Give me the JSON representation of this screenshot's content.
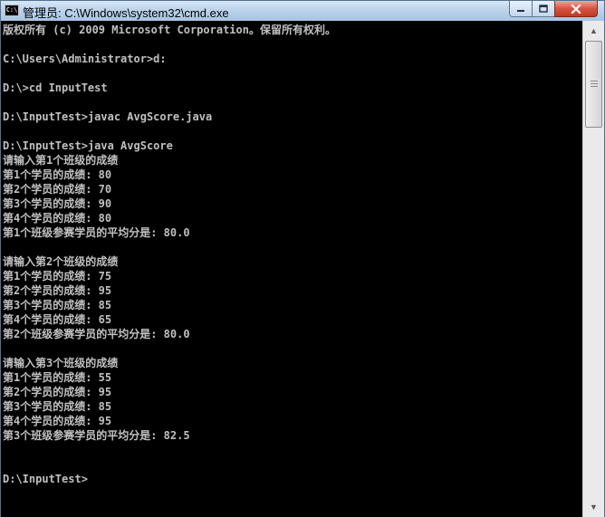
{
  "window": {
    "title": "管理员: C:\\Windows\\system32\\cmd.exe",
    "icon": "cmd-icon",
    "icon_text": "C:\\"
  },
  "controls": {
    "minimize_icon": "minimize-icon",
    "maximize_icon": "maximize-icon",
    "close_icon": "close-icon"
  },
  "console": {
    "lines": [
      "版权所有 (c) 2009 Microsoft Corporation。保留所有权利。",
      "",
      "C:\\Users\\Administrator>d:",
      "",
      "D:\\>cd InputTest",
      "",
      "D:\\InputTest>javac AvgScore.java",
      "",
      "D:\\InputTest>java AvgScore",
      "请输入第1个班级的成绩",
      "第1个学员的成绩: 80",
      "第2个学员的成绩: 70",
      "第3个学员的成绩: 90",
      "第4个学员的成绩: 80",
      "第1个班级参赛学员的平均分是: 80.0",
      "",
      "请输入第2个班级的成绩",
      "第1个学员的成绩: 75",
      "第2个学员的成绩: 95",
      "第3个学员的成绩: 85",
      "第4个学员的成绩: 65",
      "第2个班级参赛学员的平均分是: 80.0",
      "",
      "请输入第3个班级的成绩",
      "第1个学员的成绩: 55",
      "第2个学员的成绩: 95",
      "第3个学员的成绩: 85",
      "第4个学员的成绩: 95",
      "第3个班级参赛学员的平均分是: 82.5",
      "",
      "",
      "D:\\InputTest>"
    ],
    "text_color": "#c0c0c0",
    "background": "#000000"
  },
  "scrollbar": {
    "up_icon": "scroll-up-arrow-icon",
    "down_icon": "scroll-down-arrow-icon"
  }
}
